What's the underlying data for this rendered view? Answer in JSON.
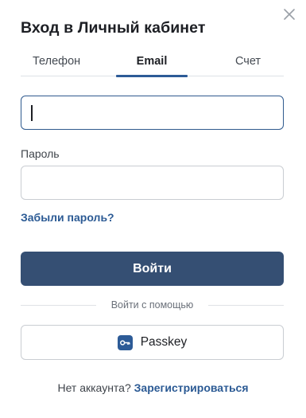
{
  "dialog": {
    "title": "Вход в Личный кабинет"
  },
  "tabs": [
    {
      "label": "Телефон",
      "active": false
    },
    {
      "label": "Email",
      "active": true
    },
    {
      "label": "Счет",
      "active": false
    }
  ],
  "email_field": {
    "value": "",
    "placeholder": ""
  },
  "password_field": {
    "label": "Пароль",
    "value": "",
    "placeholder": ""
  },
  "links": {
    "forgot_password": "Забыли пароль?",
    "register": "Зарегистрироваться"
  },
  "buttons": {
    "login": "Войти",
    "passkey": "Passkey"
  },
  "divider": {
    "text": "Войти с помощью"
  },
  "footer": {
    "no_account": "Нет аккаунта?"
  },
  "icons": {
    "close": "close-icon",
    "passkey": "key-icon"
  },
  "colors": {
    "accent": "#2d5b97",
    "primary_button": "#354f73",
    "link": "#2b5a94",
    "focused_border": "#2f5a8e"
  }
}
